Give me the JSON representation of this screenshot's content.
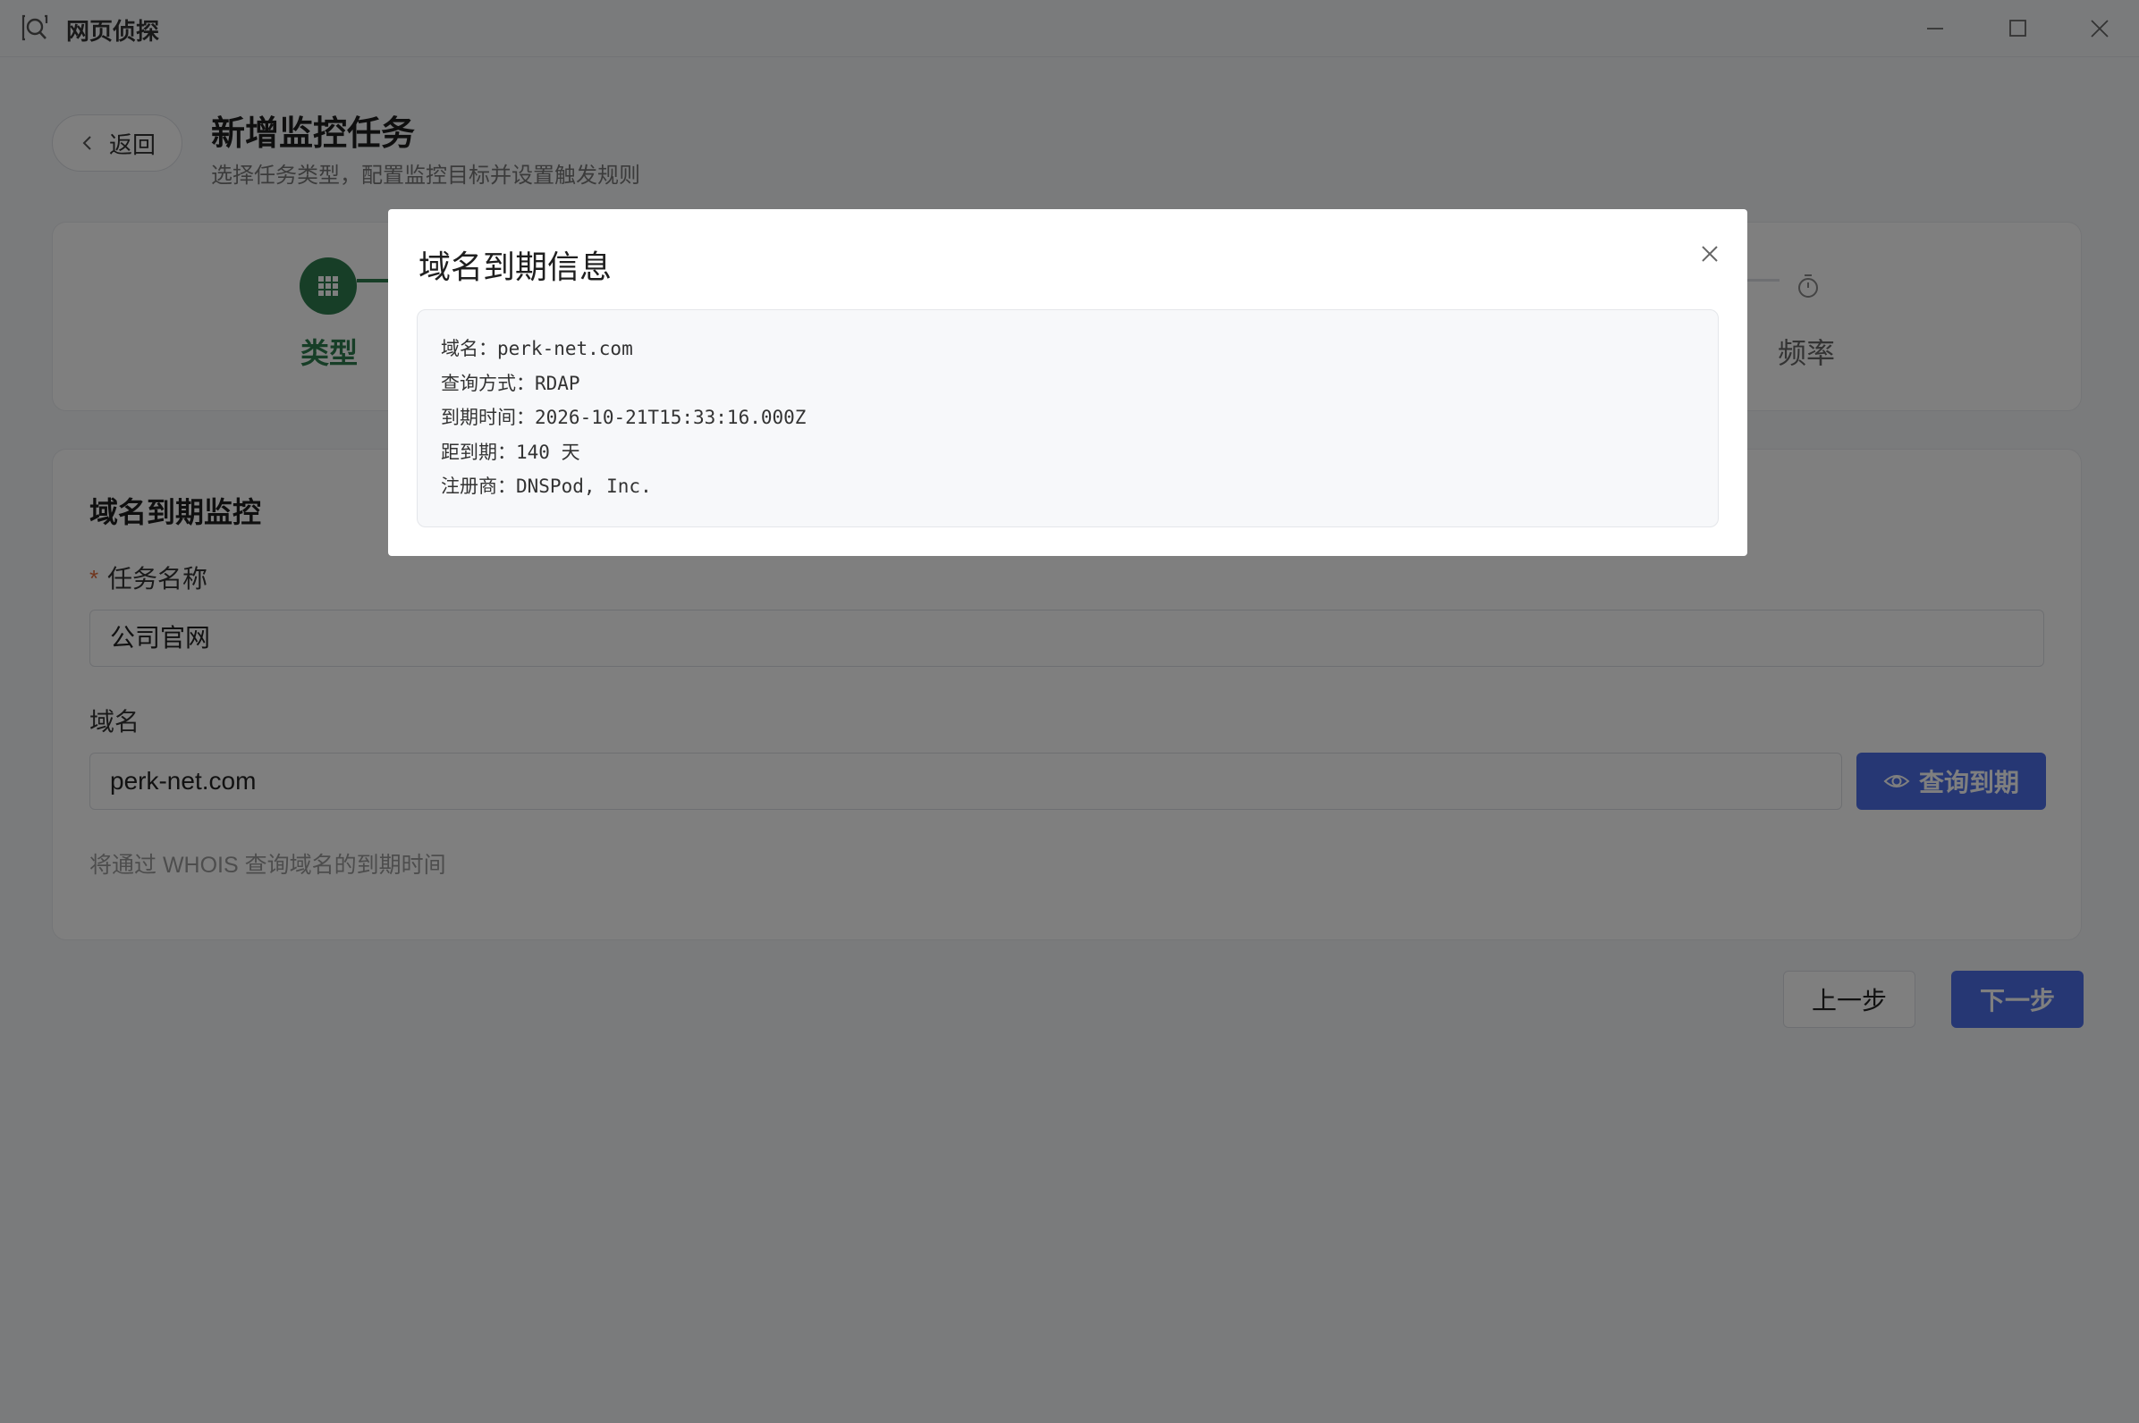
{
  "window": {
    "title": "网页侦探"
  },
  "header": {
    "back_label": "返回",
    "title": "新增监控任务",
    "subtitle": "选择任务类型，配置监控目标并设置触发规则"
  },
  "steps": {
    "active_label": "类型",
    "last_label": "频率"
  },
  "form": {
    "section_title": "域名到期监控",
    "required_mark": "*",
    "name_label": "任务名称",
    "name_value": "公司官网",
    "domain_label": "域名",
    "domain_value": "perk-net.com",
    "query_button": "查询到期",
    "hint": "将通过 WHOIS 查询域名的到期时间"
  },
  "footer": {
    "prev_label": "上一步",
    "next_label": "下一步"
  },
  "modal": {
    "title": "域名到期信息",
    "lines": [
      "域名：perk-net.com",
      "查询方式：RDAP",
      "到期时间：2026-10-21T15:33:16.000Z",
      "距到期：140 天",
      "注册商：DNSPod, Inc."
    ]
  },
  "colors": {
    "primary": "#4d6fe8",
    "step_active": "#2e7d4f",
    "required": "#e06c3c"
  },
  "icons": {
    "app": "search-window-icon",
    "back": "chevron-left-icon",
    "step_type": "grid-icon",
    "step_frequency": "stopwatch-icon",
    "query": "eye-icon",
    "close": "close-icon"
  }
}
